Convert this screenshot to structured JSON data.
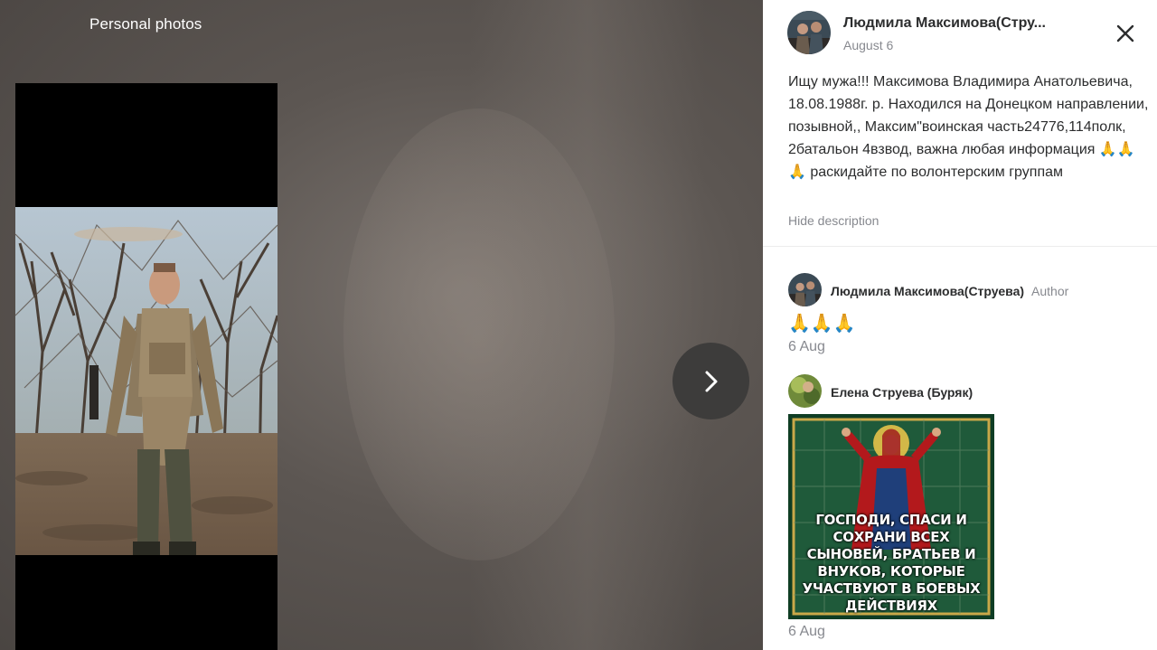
{
  "viewer": {
    "album_title": "Personal photos",
    "next_button_icon": "chevron-right-icon"
  },
  "post": {
    "author_name": "Людмила Максимова(Стру...",
    "date": "August 6",
    "description": "Ищу мужа!!! Максимова Владимира Анатольевича, 18.08.1988г. р. Находился на Донецком направлении, позывной,, Максим\"воинская часть24776,114полк, 2батальон 4взвод, важна любая информация 🙏🙏🙏 раскидайте по волонтерским группам",
    "hide_description": "Hide description",
    "close_icon": "close-icon"
  },
  "comments": [
    {
      "author": "Людмила Максимова(Струева)",
      "badge": "Author",
      "text": "🙏🙏🙏",
      "date": "6 Aug"
    },
    {
      "author": "Елена Струева (Буряк)",
      "image_text": "ГОСПОДИ, СПАСИ И СОХРАНИ ВСЕХ СЫНОВЕЙ, БРАТЬЕВ И ВНУКОВ, КОТОРЫЕ УЧАСТВУЮТ В БОЕВЫХ ДЕЙСТВИЯХ",
      "date": "6 Aug"
    }
  ],
  "colors": {
    "text_primary": "#2c2d2e",
    "text_secondary": "#87898f",
    "next_button_bg": "#3d3c3b"
  }
}
